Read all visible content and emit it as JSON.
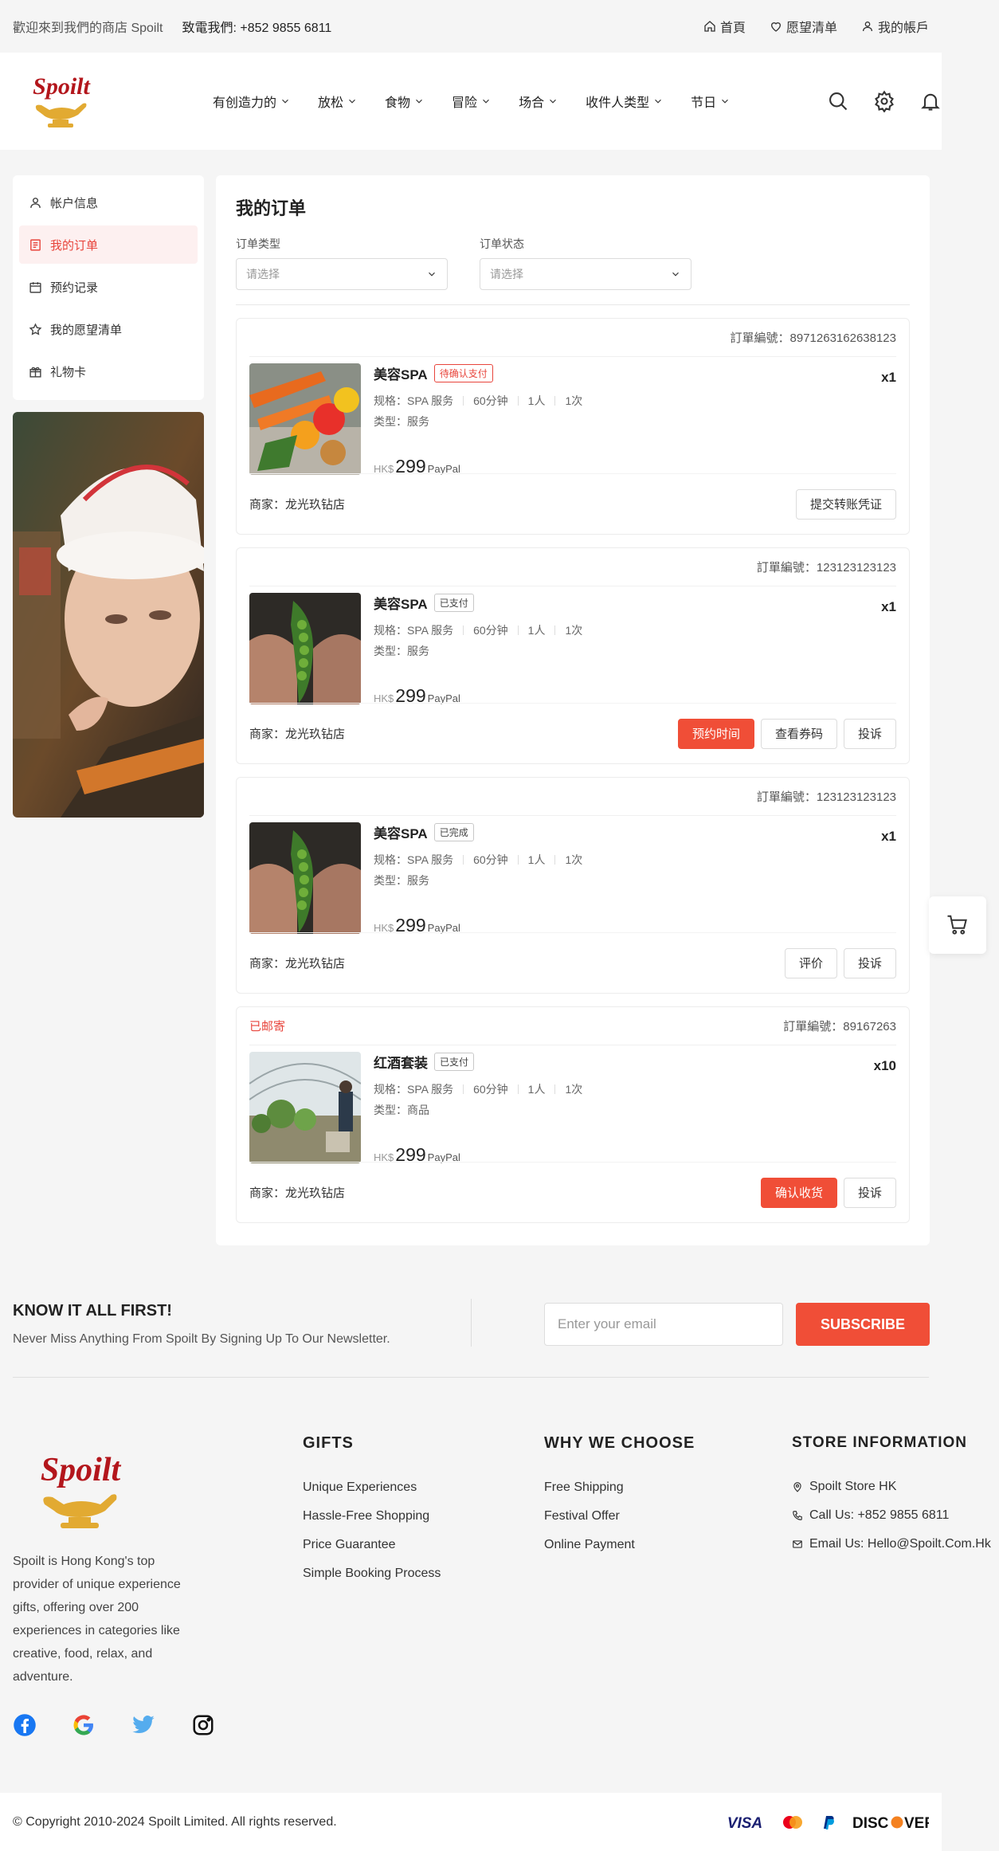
{
  "topbar": {
    "welcome": "歡迎來到我們的商店 Spoilt",
    "phone": "致電我們: +852 9855 6811",
    "links": [
      {
        "label": "首頁",
        "icon": "home-icon"
      },
      {
        "label": "愿望清单",
        "icon": "heart-icon"
      },
      {
        "label": "我的帳戶",
        "icon": "user-icon"
      }
    ]
  },
  "brand": {
    "name": "Spoilt",
    "color_red": "#b3161c",
    "color_gold": "#e2aa32"
  },
  "nav": [
    {
      "label": "有创造力的"
    },
    {
      "label": "放松"
    },
    {
      "label": "食物"
    },
    {
      "label": "冒险"
    },
    {
      "label": "场合"
    },
    {
      "label": "收件人类型"
    },
    {
      "label": "节日"
    }
  ],
  "sidebar": {
    "items": [
      {
        "label": "帐户信息",
        "icon": "user-icon",
        "active": false
      },
      {
        "label": "我的订单",
        "icon": "orders-icon",
        "active": true
      },
      {
        "label": "预约记录",
        "icon": "calendar-icon",
        "active": false
      },
      {
        "label": "我的愿望清单",
        "icon": "star-icon",
        "active": false
      },
      {
        "label": "礼物卡",
        "icon": "gift-icon",
        "active": false
      }
    ]
  },
  "main": {
    "title": "我的订单",
    "filters": [
      {
        "label": "订单类型",
        "placeholder": "请选择"
      },
      {
        "label": "订单状态",
        "placeholder": "请选择"
      }
    ],
    "orders": [
      {
        "shipping": "",
        "order_no": "訂單編號：8971263162638123",
        "product": "美容SPA",
        "status": "待确认支付",
        "qty": "x1",
        "specs": [
          "规格：SPA 服务",
          "60分钟",
          "1人",
          "1次"
        ],
        "type": "类型：服务",
        "currency": "HK$",
        "price": "299",
        "payment": "PayPal",
        "merchant": "商家：龙光玖钻店",
        "buttons": [
          {
            "label": "提交转账凭证",
            "primary": false
          }
        ]
      },
      {
        "shipping": "",
        "order_no": "訂單編號：123123123123",
        "product": "美容SPA",
        "status": "已支付",
        "qty": "x1",
        "specs": [
          "规格：SPA 服务",
          "60分钟",
          "1人",
          "1次"
        ],
        "type": "类型：服务",
        "currency": "HK$",
        "price": "299",
        "payment": "PayPal",
        "merchant": "商家：龙光玖钻店",
        "buttons": [
          {
            "label": "预约时间",
            "primary": true
          },
          {
            "label": "查看券码",
            "primary": false
          },
          {
            "label": "投诉",
            "primary": false
          }
        ]
      },
      {
        "shipping": "",
        "order_no": "訂單編號：123123123123",
        "product": "美容SPA",
        "status": "已完成",
        "qty": "x1",
        "specs": [
          "规格：SPA 服务",
          "60分钟",
          "1人",
          "1次"
        ],
        "type": "类型：服务",
        "currency": "HK$",
        "price": "299",
        "payment": "PayPal",
        "merchant": "商家：龙光玖钻店",
        "buttons": [
          {
            "label": "评价",
            "primary": false
          },
          {
            "label": "投诉",
            "primary": false
          }
        ]
      },
      {
        "shipping": "已邮寄",
        "order_no": "訂單編號：89167263",
        "product": "红酒套装",
        "status": "已支付",
        "qty": "x10",
        "specs": [
          "规格：SPA 服务",
          "60分钟",
          "1人",
          "1次"
        ],
        "type": "类型：商品",
        "currency": "HK$",
        "price": "299",
        "payment": "PayPal",
        "merchant": "商家：龙光玖钻店",
        "buttons": [
          {
            "label": "确认收货",
            "primary": true
          },
          {
            "label": "投诉",
            "primary": false
          }
        ]
      }
    ]
  },
  "newsletter": {
    "title": "KNOW IT ALL FIRST!",
    "subtitle": "Never Miss Anything From Spoilt By Signing Up To Our Newsletter.",
    "placeholder": "Enter your email",
    "button": "SUBSCRIBE"
  },
  "footer": {
    "about": "Spoilt is Hong Kong's top provider of unique experience gifts, offering over 200 experiences in categories like creative, food, relax, and adventure.",
    "columns": [
      {
        "title": "GIFTS",
        "links": [
          "Unique Experiences",
          "Hassle-Free Shopping",
          "Price Guarantee",
          "Simple Booking Process"
        ]
      },
      {
        "title": "WHY WE CHOOSE",
        "links": [
          "Free Shipping",
          "Festival Offer",
          "Online Payment"
        ]
      },
      {
        "title": "STORE INFORMATION",
        "links": [
          "Spoilt Store HK",
          "Call Us: +852 9855 6811",
          "Email Us: Hello@Spoilt.Com.Hk"
        ]
      }
    ],
    "social": [
      "facebook-icon",
      "google-icon",
      "twitter-icon",
      "instagram-icon"
    ],
    "copyright": "© Copyright 2010-2024 Spoilt Limited. All rights reserved.",
    "payment_cards": [
      "VISA",
      "mastercard",
      "paypal",
      "DISCOVER"
    ]
  }
}
